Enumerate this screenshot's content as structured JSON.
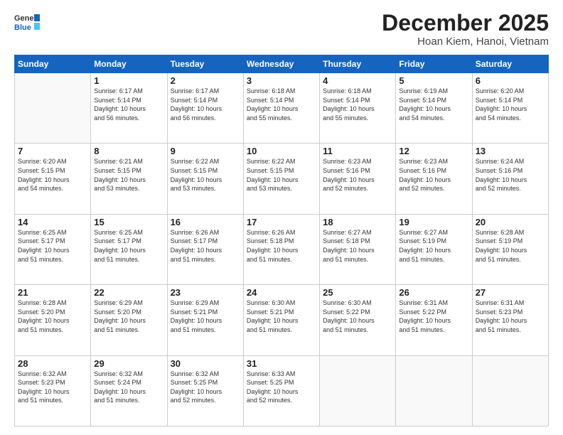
{
  "header": {
    "logo_general": "General",
    "logo_blue": "Blue",
    "month_title": "December 2025",
    "subtitle": "Hoan Kiem, Hanoi, Vietnam"
  },
  "weekdays": [
    "Sunday",
    "Monday",
    "Tuesday",
    "Wednesday",
    "Thursday",
    "Friday",
    "Saturday"
  ],
  "weeks": [
    [
      {
        "day": "",
        "info": ""
      },
      {
        "day": "1",
        "info": "Sunrise: 6:17 AM\nSunset: 5:14 PM\nDaylight: 10 hours\nand 56 minutes."
      },
      {
        "day": "2",
        "info": "Sunrise: 6:17 AM\nSunset: 5:14 PM\nDaylight: 10 hours\nand 56 minutes."
      },
      {
        "day": "3",
        "info": "Sunrise: 6:18 AM\nSunset: 5:14 PM\nDaylight: 10 hours\nand 55 minutes."
      },
      {
        "day": "4",
        "info": "Sunrise: 6:18 AM\nSunset: 5:14 PM\nDaylight: 10 hours\nand 55 minutes."
      },
      {
        "day": "5",
        "info": "Sunrise: 6:19 AM\nSunset: 5:14 PM\nDaylight: 10 hours\nand 54 minutes."
      },
      {
        "day": "6",
        "info": "Sunrise: 6:20 AM\nSunset: 5:14 PM\nDaylight: 10 hours\nand 54 minutes."
      }
    ],
    [
      {
        "day": "7",
        "info": "Sunrise: 6:20 AM\nSunset: 5:15 PM\nDaylight: 10 hours\nand 54 minutes."
      },
      {
        "day": "8",
        "info": "Sunrise: 6:21 AM\nSunset: 5:15 PM\nDaylight: 10 hours\nand 53 minutes."
      },
      {
        "day": "9",
        "info": "Sunrise: 6:22 AM\nSunset: 5:15 PM\nDaylight: 10 hours\nand 53 minutes."
      },
      {
        "day": "10",
        "info": "Sunrise: 6:22 AM\nSunset: 5:15 PM\nDaylight: 10 hours\nand 53 minutes."
      },
      {
        "day": "11",
        "info": "Sunrise: 6:23 AM\nSunset: 5:16 PM\nDaylight: 10 hours\nand 52 minutes."
      },
      {
        "day": "12",
        "info": "Sunrise: 6:23 AM\nSunset: 5:16 PM\nDaylight: 10 hours\nand 52 minutes."
      },
      {
        "day": "13",
        "info": "Sunrise: 6:24 AM\nSunset: 5:16 PM\nDaylight: 10 hours\nand 52 minutes."
      }
    ],
    [
      {
        "day": "14",
        "info": "Sunrise: 6:25 AM\nSunset: 5:17 PM\nDaylight: 10 hours\nand 51 minutes."
      },
      {
        "day": "15",
        "info": "Sunrise: 6:25 AM\nSunset: 5:17 PM\nDaylight: 10 hours\nand 51 minutes."
      },
      {
        "day": "16",
        "info": "Sunrise: 6:26 AM\nSunset: 5:17 PM\nDaylight: 10 hours\nand 51 minutes."
      },
      {
        "day": "17",
        "info": "Sunrise: 6:26 AM\nSunset: 5:18 PM\nDaylight: 10 hours\nand 51 minutes."
      },
      {
        "day": "18",
        "info": "Sunrise: 6:27 AM\nSunset: 5:18 PM\nDaylight: 10 hours\nand 51 minutes."
      },
      {
        "day": "19",
        "info": "Sunrise: 6:27 AM\nSunset: 5:19 PM\nDaylight: 10 hours\nand 51 minutes."
      },
      {
        "day": "20",
        "info": "Sunrise: 6:28 AM\nSunset: 5:19 PM\nDaylight: 10 hours\nand 51 minutes."
      }
    ],
    [
      {
        "day": "21",
        "info": "Sunrise: 6:28 AM\nSunset: 5:20 PM\nDaylight: 10 hours\nand 51 minutes."
      },
      {
        "day": "22",
        "info": "Sunrise: 6:29 AM\nSunset: 5:20 PM\nDaylight: 10 hours\nand 51 minutes."
      },
      {
        "day": "23",
        "info": "Sunrise: 6:29 AM\nSunset: 5:21 PM\nDaylight: 10 hours\nand 51 minutes."
      },
      {
        "day": "24",
        "info": "Sunrise: 6:30 AM\nSunset: 5:21 PM\nDaylight: 10 hours\nand 51 minutes."
      },
      {
        "day": "25",
        "info": "Sunrise: 6:30 AM\nSunset: 5:22 PM\nDaylight: 10 hours\nand 51 minutes."
      },
      {
        "day": "26",
        "info": "Sunrise: 6:31 AM\nSunset: 5:22 PM\nDaylight: 10 hours\nand 51 minutes."
      },
      {
        "day": "27",
        "info": "Sunrise: 6:31 AM\nSunset: 5:23 PM\nDaylight: 10 hours\nand 51 minutes."
      }
    ],
    [
      {
        "day": "28",
        "info": "Sunrise: 6:32 AM\nSunset: 5:23 PM\nDaylight: 10 hours\nand 51 minutes."
      },
      {
        "day": "29",
        "info": "Sunrise: 6:32 AM\nSunset: 5:24 PM\nDaylight: 10 hours\nand 51 minutes."
      },
      {
        "day": "30",
        "info": "Sunrise: 6:32 AM\nSunset: 5:25 PM\nDaylight: 10 hours\nand 52 minutes."
      },
      {
        "day": "31",
        "info": "Sunrise: 6:33 AM\nSunset: 5:25 PM\nDaylight: 10 hours\nand 52 minutes."
      },
      {
        "day": "",
        "info": ""
      },
      {
        "day": "",
        "info": ""
      },
      {
        "day": "",
        "info": ""
      }
    ]
  ]
}
